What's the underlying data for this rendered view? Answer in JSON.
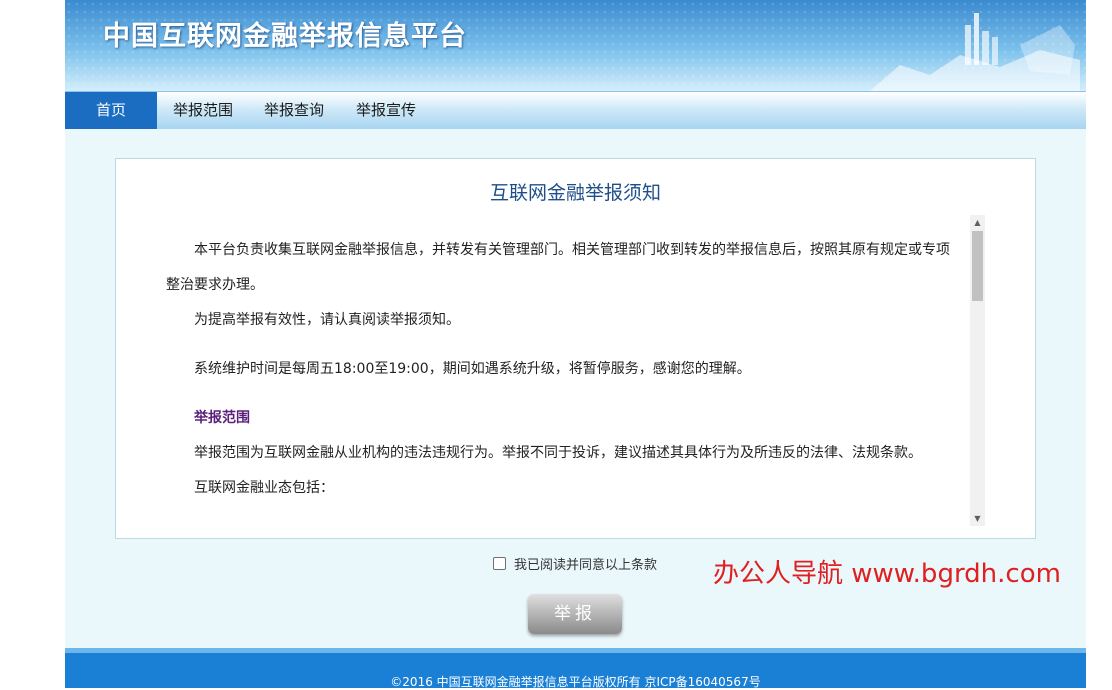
{
  "header": {
    "site_title": "中国互联网金融举报信息平台"
  },
  "nav": {
    "items": [
      {
        "label": "首页",
        "active": true
      },
      {
        "label": "举报范围",
        "active": false
      },
      {
        "label": "举报查询",
        "active": false
      },
      {
        "label": "举报宣传",
        "active": false
      }
    ]
  },
  "notice": {
    "title": "互联网金融举报须知",
    "paragraphs": [
      "本平台负责收集互联网金融举报信息，并转发有关管理部门。相关管理部门收到转发的举报信息后，按照其原有规定或专项整治要求办理。",
      "为提高举报有效性，请认真阅读举报须知。",
      "系统维护时间是每周五18:00至19:00，期间如遇系统升级，将暂停服务，感谢您的理解。",
      "举报范围",
      "举报范围为互联网金融从业机构的违法违规行为。举报不同于投诉，建议描述其具体行为及所违反的法律、法规条款。",
      "互联网金融业态包括："
    ]
  },
  "agreement": {
    "label": "我已阅读并同意以上条款",
    "checked": false
  },
  "submit_label": "举报",
  "footer": {
    "text": "©2016 中国互联网金融举报信息平台版权所有 京ICP备16040567号"
  },
  "watermark": "办公人导航 www.bgrdh.com",
  "colors": {
    "nav_active": "#1a6dc0",
    "footer": "#1a80d6",
    "title": "#1f4f8a",
    "section_heading": "#5a1f7a"
  }
}
